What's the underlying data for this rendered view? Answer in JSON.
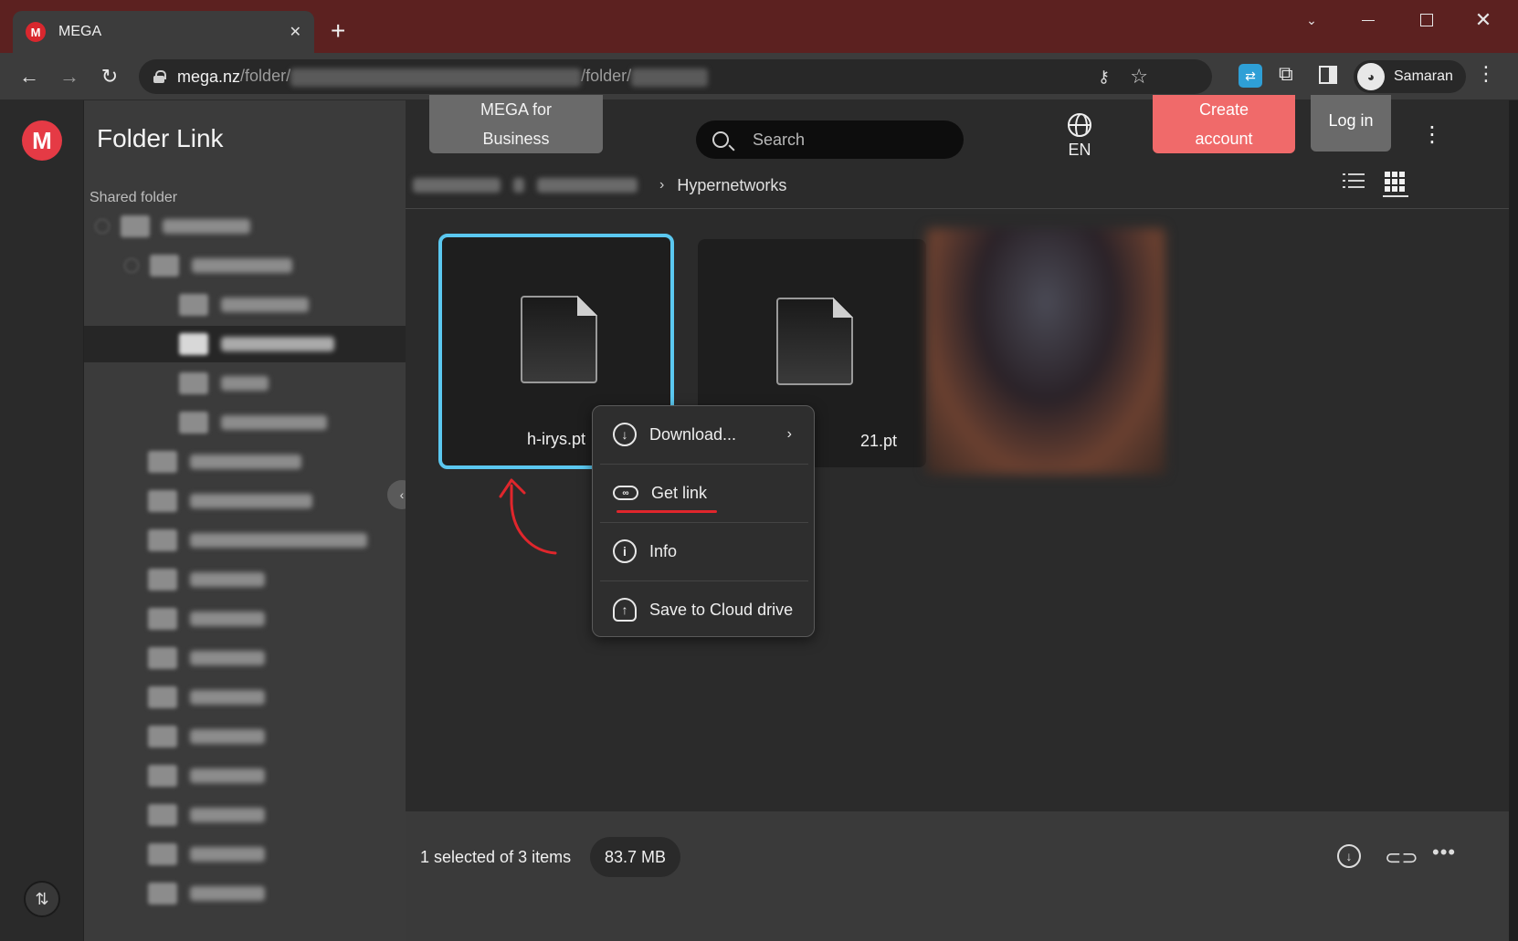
{
  "browser": {
    "tab_title": "MEGA",
    "tab_favicon": "M",
    "url_host": "mega.nz",
    "url_path_1": "/folder/",
    "url_path_2": "/folder/",
    "profile_name": "Samaran"
  },
  "icons": {
    "back": "←",
    "forward": "→",
    "reload": "↻",
    "star": "☆",
    "key": "⚷",
    "puzzle": "⧉",
    "kebab": "⋮",
    "close": "✕",
    "plus": "+",
    "chevron_down": "⌄"
  },
  "app": {
    "logo_letter": "M",
    "sidebar_title": "Folder Link",
    "shared_label": "Shared folder",
    "collapse_glyph": "‹",
    "transfer_glyph": "⇅"
  },
  "header": {
    "business_line1": "MEGA for",
    "business_line2": "Business",
    "search_placeholder": "Search",
    "lang": "EN",
    "create_line1": "Create",
    "create_line2": "account",
    "login": "Log in"
  },
  "breadcrumb": {
    "current": "Hypernetworks",
    "separator": "›"
  },
  "files": [
    {
      "name": "h-irys.pt",
      "selected": true
    },
    {
      "name": "21.pt",
      "selected": false
    }
  ],
  "context_menu": {
    "download": "Download...",
    "download_chevron": "›",
    "get_link": "Get link",
    "info": "Info",
    "save": "Save to Cloud drive"
  },
  "status": {
    "selection": "1 selected of 3 items",
    "size": "83.7 MB"
  },
  "colors": {
    "selected_border": "#5bc8f0",
    "create_account": "#f06a6a",
    "brand_red": "#e53a45",
    "annotation_red": "#e0262c"
  }
}
